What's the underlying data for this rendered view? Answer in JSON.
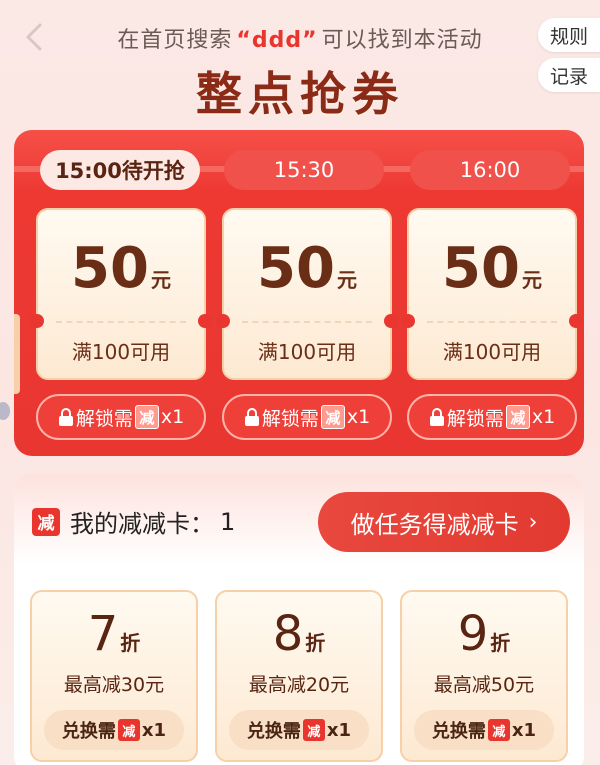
{
  "header": {
    "hint_prefix": "在首页搜索",
    "hint_keyword": "“ddd”",
    "hint_suffix": "可以找到本活动",
    "title": "整点抢券",
    "rules_label": "规则",
    "record_label": "记录"
  },
  "time_tabs": [
    {
      "label": "15:00待开抢",
      "active": true
    },
    {
      "label": "15:30",
      "active": false
    },
    {
      "label": "16:00",
      "active": false
    }
  ],
  "coupons": [
    {
      "amount": "50",
      "unit": "元",
      "condition": "满100可用",
      "unlock_prefix": "解锁需",
      "badge": "减",
      "unlock_suffix": "x1"
    },
    {
      "amount": "50",
      "unit": "元",
      "condition": "满100可用",
      "unlock_prefix": "解锁需",
      "badge": "减",
      "unlock_suffix": "x1"
    },
    {
      "amount": "50",
      "unit": "元",
      "condition": "满100可用",
      "unlock_prefix": "解锁需",
      "badge": "减",
      "unlock_suffix": "x1"
    }
  ],
  "card": {
    "badge": "减",
    "label": "我的减减卡：",
    "count": "1",
    "task_button": "做任务得减减卡",
    "task_chevron": "›"
  },
  "discounts": [
    {
      "value": "7",
      "unit": "折",
      "max": "最高减30元",
      "exchange_prefix": "兑换需",
      "badge": "减",
      "exchange_suffix": "x1"
    },
    {
      "value": "8",
      "unit": "折",
      "max": "最高减20元",
      "exchange_prefix": "兑换需",
      "badge": "减",
      "exchange_suffix": "x1"
    },
    {
      "value": "9",
      "unit": "折",
      "max": "最高减50元",
      "exchange_prefix": "兑换需",
      "badge": "减",
      "exchange_suffix": "x1"
    }
  ],
  "colors": {
    "primary_red": "#e93630",
    "title_brown": "#8a2a17",
    "coupon_text": "#6a2e16"
  }
}
